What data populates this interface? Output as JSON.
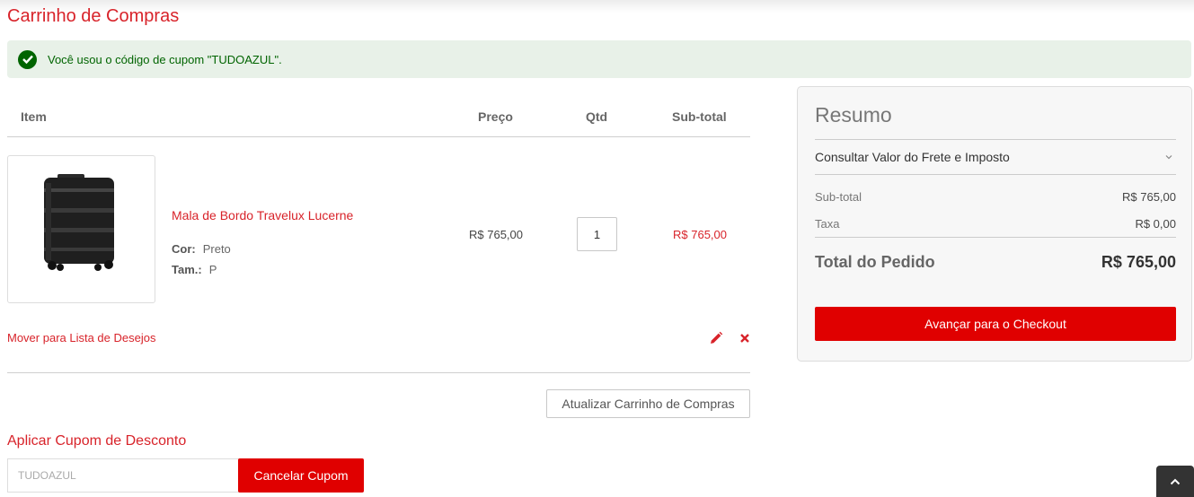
{
  "page": {
    "title": "Carrinho de Compras"
  },
  "message": {
    "text": "Você usou o código de cupom \"TUDOAZUL\".",
    "icon": "check-circle-icon",
    "color": "#006400"
  },
  "cart": {
    "headers": {
      "item": "Item",
      "price": "Preço",
      "qty": "Qtd",
      "subtotal": "Sub-total"
    },
    "item": {
      "name": "Mala de Bordo Travelux Lucerne",
      "options": [
        {
          "label": "Cor:",
          "value": "Preto"
        },
        {
          "label": "Tam.:",
          "value": "P"
        }
      ],
      "price": "R$ 765,00",
      "qty": "1",
      "subtotal": "R$ 765,00"
    },
    "move_to_wishlist": "Mover para Lista de Desejos",
    "update_label": "Atualizar Carrinho de Compras"
  },
  "coupon": {
    "title": "Aplicar Cupom de Desconto",
    "value": "TUDOAZUL",
    "cancel_label": "Cancelar Cupom"
  },
  "summary": {
    "title": "Resumo",
    "shipping_label": "Consultar Valor do Frete e Imposto",
    "subtotal_label": "Sub-total",
    "subtotal_value": "R$ 765,00",
    "tax_label": "Taxa",
    "tax_value": "R$ 0,00",
    "total_label": "Total do Pedido",
    "total_value": "R$ 765,00",
    "checkout_label": "Avançar para o Checkout"
  },
  "colors": {
    "accent": "#d8232a",
    "button": "#e00000"
  }
}
